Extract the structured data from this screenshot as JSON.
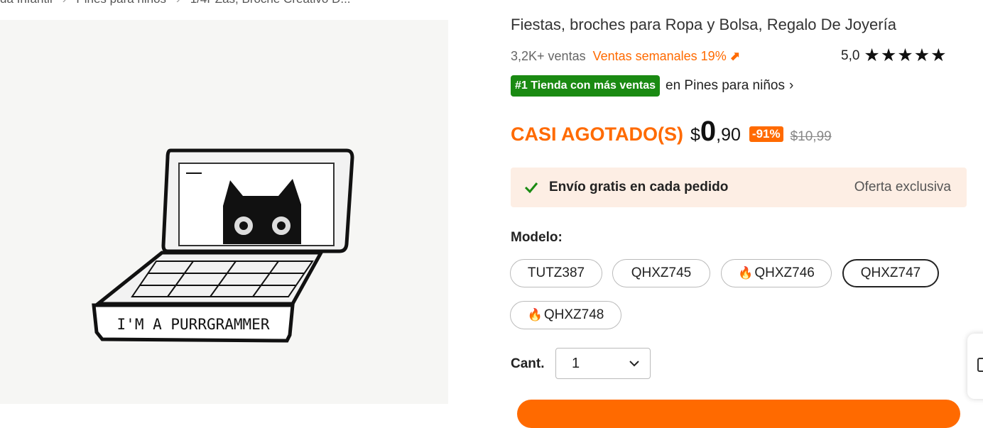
{
  "breadcrumb": {
    "items": [
      "da Infantil",
      "Pines para niños",
      "1/4PZas, Broche Creativo D..."
    ]
  },
  "product": {
    "pin_text": "I'M A PURRGRAMMER",
    "title": "Fiestas, broches para Ropa y Bolsa, Regalo De Joyería",
    "sales_count": "3,2K+ ventas",
    "weekly_sales": "Ventas semanales 19%",
    "rating_value": "5,0",
    "rating_stars": 5,
    "top_badge": "#1 Tienda con más ventas",
    "store_category": "en Pines para niños"
  },
  "price": {
    "stock_status": "CASI AGOTADO(S)",
    "currency": "$",
    "integer": "0",
    "decimal": ",90",
    "discount": "-91%",
    "original": "$10,99"
  },
  "shipping": {
    "text": "Envío gratis en cada pedido",
    "offer": "Oferta exclusiva"
  },
  "variants": {
    "label": "Modelo:",
    "options": [
      {
        "name": "TUTZ387",
        "hot": false,
        "selected": false
      },
      {
        "name": "QHXZ745",
        "hot": false,
        "selected": false
      },
      {
        "name": "QHXZ746",
        "hot": true,
        "selected": false
      },
      {
        "name": "QHXZ747",
        "hot": false,
        "selected": true
      },
      {
        "name": "QHXZ748",
        "hot": true,
        "selected": false
      }
    ]
  },
  "quantity": {
    "label": "Cant.",
    "value": "1"
  },
  "colors": {
    "accent": "#ff6a00",
    "badge_green": "#1a8a12",
    "shipping_bg": "#fdeee4"
  },
  "icons": {
    "check": "check-icon",
    "flame": "flame-icon",
    "chevron": "chevron-down-icon",
    "arrow": "trending-up-icon"
  }
}
